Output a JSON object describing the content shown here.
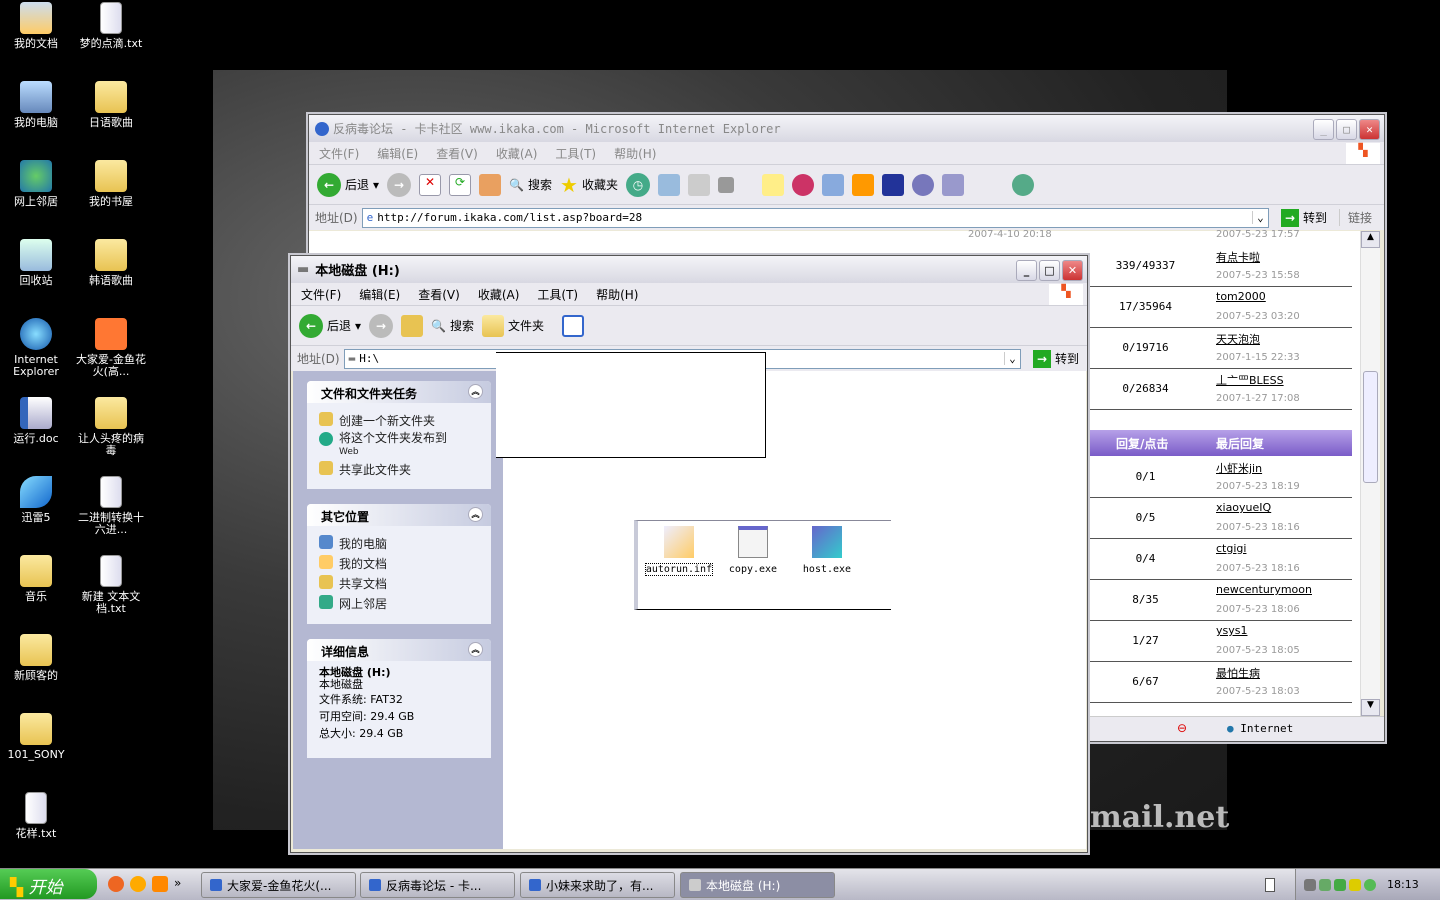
{
  "desktop": {
    "icons": [
      {
        "label": "我的文档",
        "type": "mydocs"
      },
      {
        "label": "梦的点滴.txt",
        "type": "txt"
      },
      {
        "label": "我的电脑",
        "type": "computer"
      },
      {
        "label": "日语歌曲",
        "type": "folder"
      },
      {
        "label": "网上邻居",
        "type": "network"
      },
      {
        "label": "我的书屋",
        "type": "folder"
      },
      {
        "label": "回收站",
        "type": "recycle"
      },
      {
        "label": "韩语歌曲",
        "type": "folder"
      },
      {
        "label": "Internet Explorer",
        "type": "ie"
      },
      {
        "label": "大家爱-金鱼花火(高...",
        "type": "mpg"
      },
      {
        "label": "运行.doc",
        "type": "word"
      },
      {
        "label": "让人头疼的病毒",
        "type": "folder"
      },
      {
        "label": "迅雷5",
        "type": "thunder"
      },
      {
        "label": "二进制转换十六进...",
        "type": "txt"
      },
      {
        "label": "音乐",
        "type": "folder"
      },
      {
        "label": "新建 文本文档.txt",
        "type": "txt"
      },
      {
        "label": "新顾客的",
        "type": "folder"
      },
      {
        "label": "101_SONY",
        "type": "folder"
      },
      {
        "label": "花样.txt",
        "type": "txt"
      }
    ],
    "watermark": "mail.net"
  },
  "ie": {
    "title": "反病毒论坛 - 卡卡社区 www.ikaka.com - Microsoft Internet Explorer",
    "menu": [
      "文件(F)",
      "编辑(E)",
      "查看(V)",
      "收藏(A)",
      "工具(T)",
      "帮助(H)"
    ],
    "toolbar": {
      "back": "后退",
      "search": "搜索",
      "favorites": "收藏夹"
    },
    "address_label": "地址(D)",
    "url": "http://forum.ikaka.com/list.asp?board=28",
    "go": "转到",
    "links": "链接",
    "top_dates": [
      "2007-4-10 20:18",
      "2007-5-23 17:57"
    ],
    "rows_a": [
      {
        "count": "339/49337",
        "user": "有点卡啦",
        "date": "2007-5-23 15:58"
      },
      {
        "count": "17/35964",
        "user": "tom2000",
        "date": "2007-5-23 03:20"
      },
      {
        "count": "0/19716",
        "user": "天天泡泡",
        "date": "2007-1-15 22:33"
      },
      {
        "count": "0/26834",
        "user": "丄亠罒BLESS",
        "date": "2007-1-27 17:08"
      }
    ],
    "header": {
      "col1": "回复/点击",
      "col2": "最后回复"
    },
    "rows_b": [
      {
        "count": "0/1",
        "user": "小虾米jin",
        "date": "2007-5-23 18:19"
      },
      {
        "count": "0/5",
        "user": "xiaoyueIQ",
        "date": "2007-5-23 18:16"
      },
      {
        "count": "0/4",
        "user": "ctgigi",
        "date": "2007-5-23 18:16"
      },
      {
        "count": "8/35",
        "user": "newcenturymoon",
        "date": "2007-5-23 18:06"
      },
      {
        "count": "1/27",
        "user": "ysys1",
        "date": "2007-5-23 18:05"
      },
      {
        "count": "6/67",
        "user": "最怕生病",
        "date": "2007-5-23 18:03"
      }
    ],
    "status_zone": "Internet"
  },
  "explorer": {
    "title": "本地磁盘 (H:)",
    "menu": [
      "文件(F)",
      "编辑(E)",
      "查看(V)",
      "收藏(A)",
      "工具(T)",
      "帮助(H)"
    ],
    "toolbar": {
      "back": "后退",
      "search": "搜索",
      "folders": "文件夹"
    },
    "address_label": "地址(D)",
    "path": "H:\\",
    "go": "转到",
    "tasks": {
      "title": "文件和文件夹任务",
      "items": [
        "创建一个新文件夹",
        "将这个文件夹发布到",
        "Web",
        "共享此文件夹"
      ]
    },
    "places": {
      "title": "其它位置",
      "items": [
        "我的电脑",
        "我的文档",
        "共享文档",
        "网上邻居"
      ]
    },
    "details": {
      "title": "详细信息",
      "name": "本地磁盘 (H:)",
      "type": "本地磁盘",
      "fs": "文件系统: FAT32",
      "free": "可用空间: 29.4 GB",
      "total": "总大小: 29.4 GB"
    },
    "files": [
      "autorun.inf",
      "copy.exe",
      "host.exe"
    ]
  },
  "taskbar": {
    "start": "开始",
    "tasks": [
      "大家爱-金鱼花火(...",
      "反病毒论坛 - 卡...",
      "小妹来求助了，有...",
      "本地磁盘 (H:)"
    ],
    "clock": "18:13"
  }
}
